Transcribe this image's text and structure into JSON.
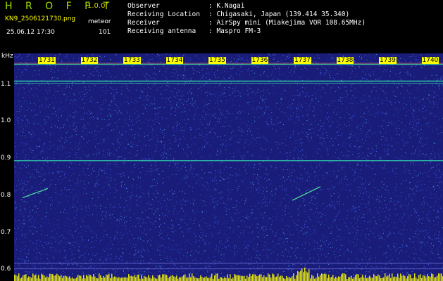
{
  "header": {
    "title": "H R O F F T",
    "version": "1.0.0f",
    "file_name": "KN9_2506121730.png",
    "mode": "meteor",
    "datetime": "25.06.12 17:30",
    "count": "101"
  },
  "info": [
    {
      "label": "Observer",
      "value": ": K.Nagai"
    },
    {
      "label": "Receiving Location",
      "value": ": Chigasaki, Japan (139.414 35.340)"
    },
    {
      "label": "Receiver",
      "value": ": AirSpy mini (Miakejima VOR 108.65MHz)"
    },
    {
      "label": "Receiving antenna",
      "value": ": Maspro FM-3"
    }
  ],
  "axis": {
    "unit": "kHz",
    "yticks": [
      "1.1",
      "1.0",
      "0.9",
      "0.8",
      "0.7",
      "0.6"
    ],
    "ytick_values": [
      1.1,
      1.0,
      0.9,
      0.8,
      0.7,
      0.6
    ],
    "ylim": [
      0.57,
      1.185
    ],
    "times": [
      "1731",
      "1732",
      "1733",
      "1734",
      "1735",
      "1736",
      "1737",
      "1738",
      "1739",
      "1740"
    ]
  },
  "colors": {
    "background": "#1a1c7a",
    "noise": "#3a55e0",
    "carrier": "#30e0b0",
    "trace": "#50ffa0",
    "bottom_noise": "#ffff00"
  }
}
